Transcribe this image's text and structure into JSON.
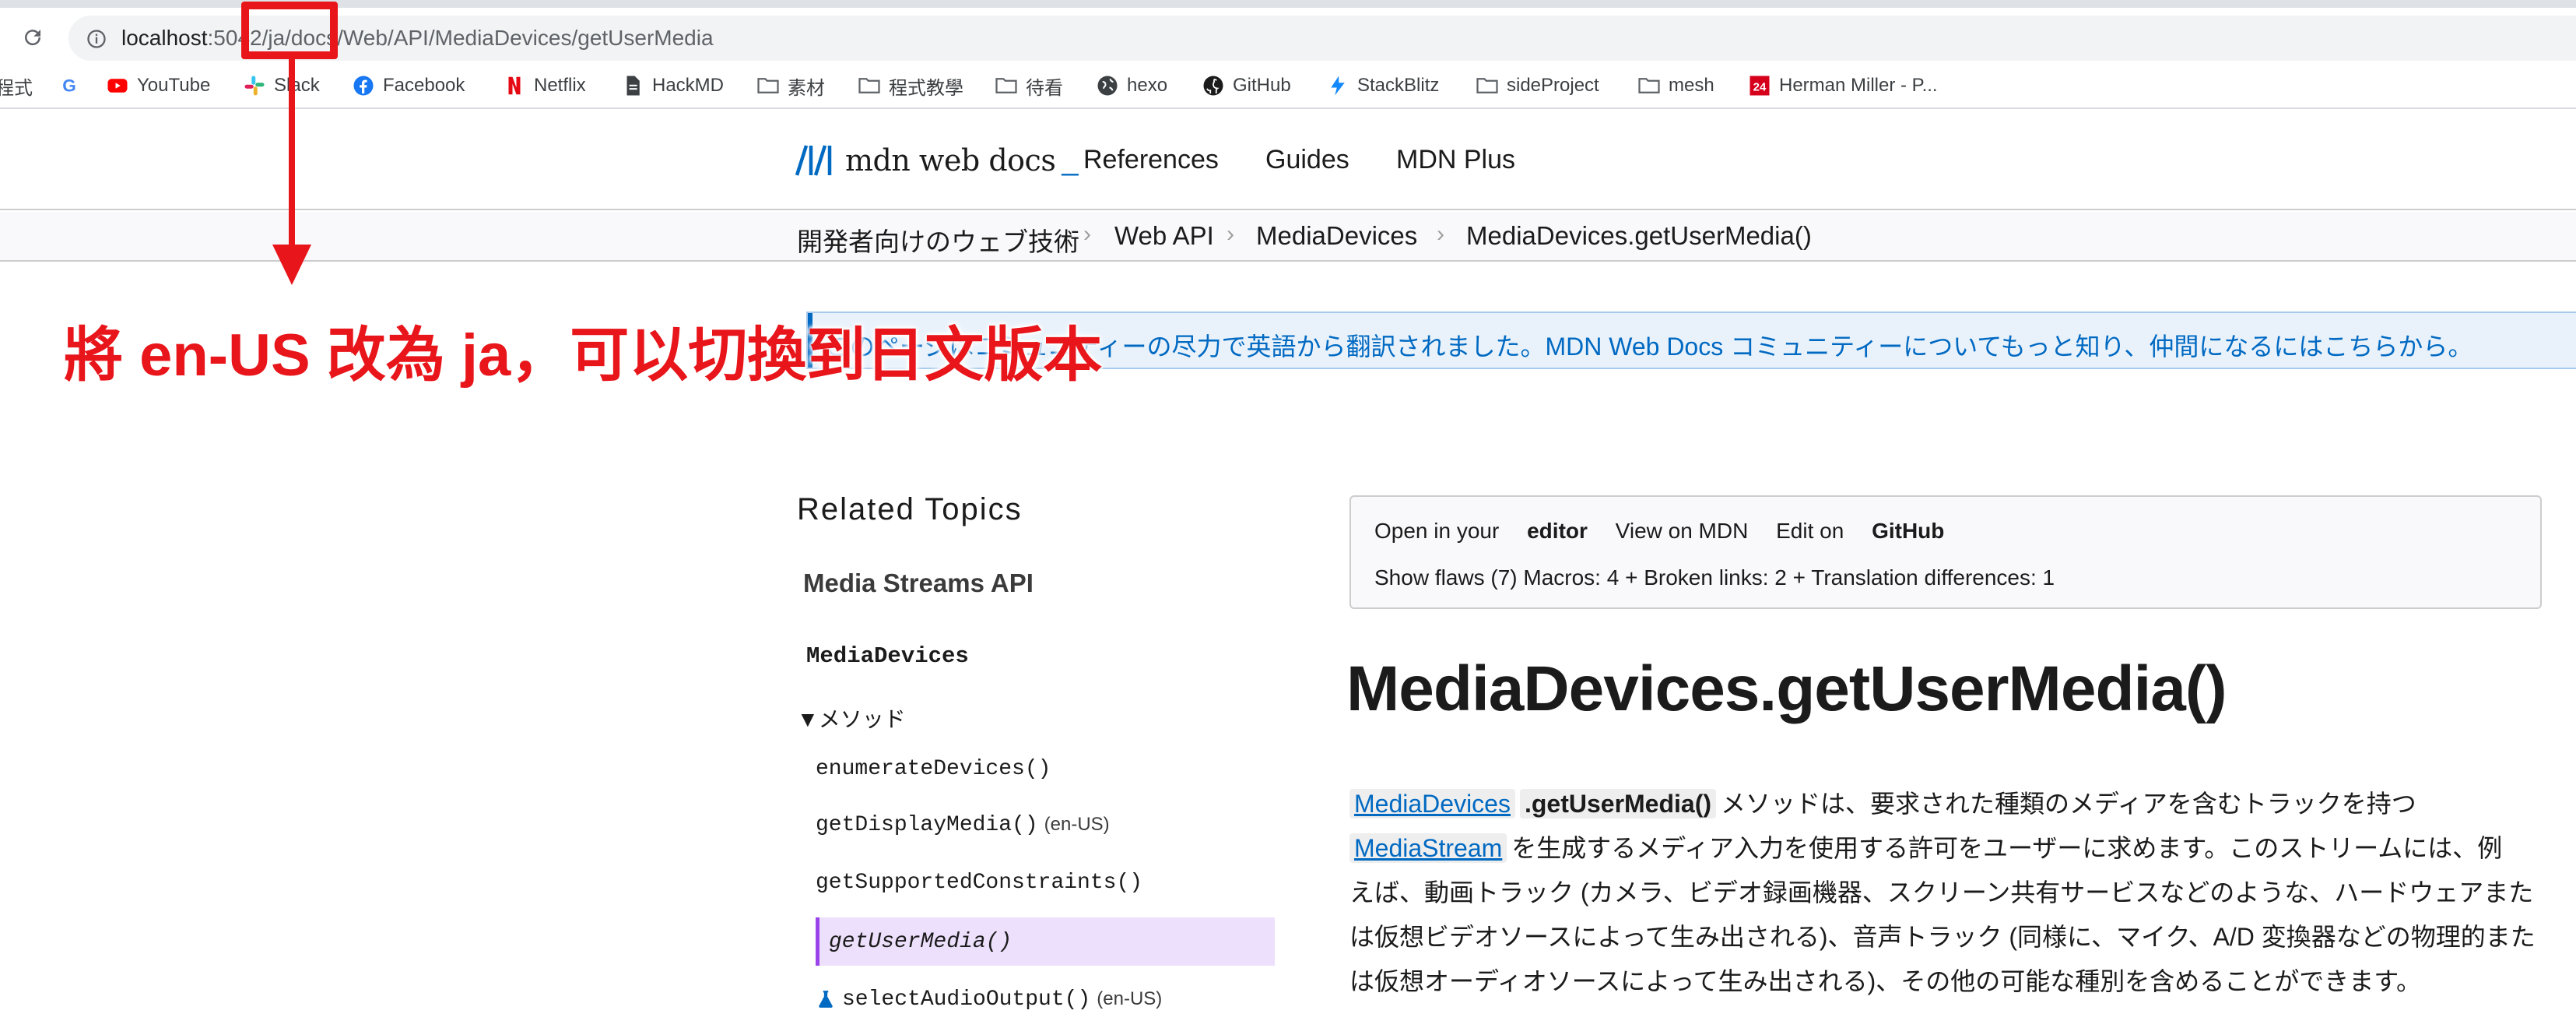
{
  "browser": {
    "url_host": "localhost",
    "url_path": ":5042/ja/docs/Web/API/MediaDevices/getUserMedia",
    "bookmarks": [
      {
        "label": "程式",
        "icon": "apps-icon"
      },
      {
        "label": "",
        "icon": "google-icon"
      },
      {
        "label": "YouTube",
        "icon": "youtube-icon"
      },
      {
        "label": "Slack",
        "icon": "slack-icon"
      },
      {
        "label": "Facebook",
        "icon": "facebook-icon"
      },
      {
        "label": "Netflix",
        "icon": "netflix-icon"
      },
      {
        "label": "HackMD",
        "icon": "document-icon"
      },
      {
        "label": "素材",
        "icon": "folder-icon"
      },
      {
        "label": "程式教學",
        "icon": "folder-icon"
      },
      {
        "label": "待看",
        "icon": "folder-icon"
      },
      {
        "label": "hexo",
        "icon": "globe-icon"
      },
      {
        "label": "GitHub",
        "icon": "github-icon"
      },
      {
        "label": "StackBlitz",
        "icon": "stackblitz-icon"
      },
      {
        "label": "sideProject",
        "icon": "folder-icon"
      },
      {
        "label": "mesh",
        "icon": "folder-icon"
      },
      {
        "label": "Herman Miller - P...",
        "icon": "herman-miller-icon"
      }
    ]
  },
  "mdn": {
    "logo_text": "mdn web docs",
    "logo_cursor": "_",
    "nav": [
      "References",
      "Guides",
      "MDN Plus"
    ],
    "breadcrumbs": [
      "開発者向けのウェブ技術",
      "Web API",
      "MediaDevices",
      "MediaDevices.getUserMedia()"
    ],
    "l10n_banner": "このページはコミュニティーの尽力で英語から翻訳されました。MDN Web Docs コミュニティーについてもっと知り、仲間になるにはこちらから。"
  },
  "annotation": {
    "text": "將 en-US 改為 ja，可以切換到日文版本",
    "color": "#e8151b"
  },
  "sidebar": {
    "title": "Related Topics",
    "api": "Media Streams API",
    "interface": "MediaDevices",
    "group": "▼メソッド",
    "items": [
      {
        "code": "enumerateDevices()",
        "lang": ""
      },
      {
        "code": "getDisplayMedia()",
        "lang": "(en-US)"
      },
      {
        "code": "getSupportedConstraints()",
        "lang": ""
      },
      {
        "code": "getUserMedia()",
        "lang": "",
        "active": true
      },
      {
        "code": "selectAudioOutput()",
        "lang": "(en-US)",
        "experimental": true
      }
    ]
  },
  "toolbar": {
    "open_prefix": "Open in your ",
    "open_bold": "editor",
    "view_on_mdn": "View on MDN",
    "edit_prefix": "Edit on ",
    "edit_bold": "GitHub",
    "flaws": "Show flaws (7) Macros: 4 + Broken links: 2 + Translation differences: 1"
  },
  "article": {
    "title": "MediaDevices.getUserMedia()",
    "chip_interface": "MediaDevices",
    "chip_method": ".getUserMedia()",
    "line1_rest": "メソッドは、要求された種類のメディアを含むトラックを持つ",
    "chip_stream": "MediaStream",
    "line2_rest": "を生成するメディア入力を使用する許可をユーザーに求めます。このストリームには、例",
    "line3": "えば、動画トラック (カメラ、ビデオ録画機器、スクリーン共有サービスなどのような、ハードウェアまた",
    "line4": "は仮想ビデオソースによって生み出される)、音声トラック (同様に、マイク、A/D 変換器などの物理的また",
    "line5": "は仮想オーディオソースによって生み出される)、その他の可能な種別を含めることができます。"
  },
  "colors": {
    "mdn_blue": "#0069c2",
    "active_purple": "#9a44ea",
    "annotation_red": "#e8151b"
  }
}
